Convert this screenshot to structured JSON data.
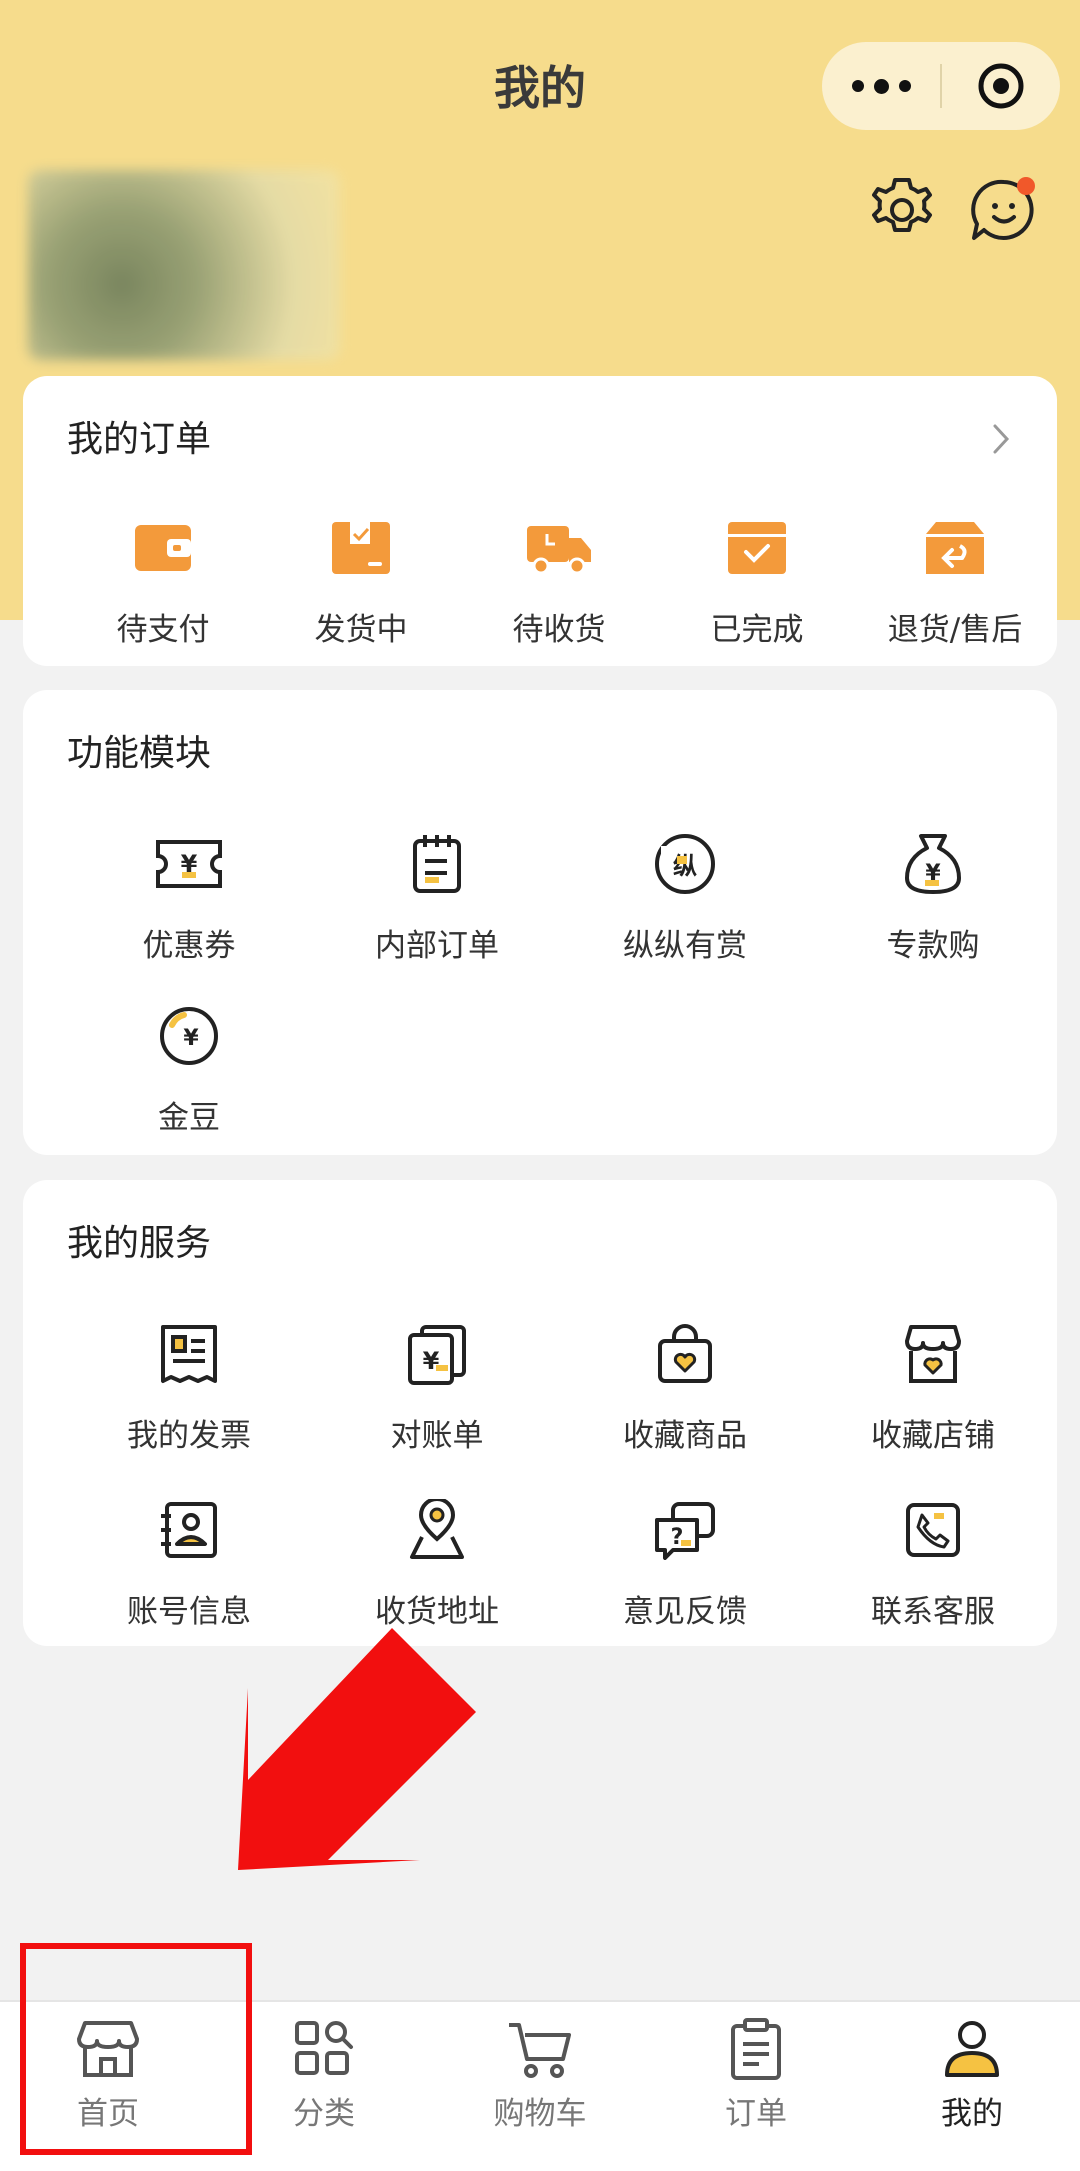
{
  "header": {
    "title": "我的"
  },
  "colors": {
    "brand_yellow": "#f6dc8c",
    "accent_orange": "#f39a3b",
    "annotation_red": "#f20f0f"
  },
  "orders": {
    "title": "我的订单",
    "items": [
      {
        "label": "待支付",
        "icon": "wallet-icon"
      },
      {
        "label": "发货中",
        "icon": "package-icon"
      },
      {
        "label": "待收货",
        "icon": "delivery-truck-icon"
      },
      {
        "label": "已完成",
        "icon": "completed-box-icon"
      },
      {
        "label": "退货/售后",
        "icon": "return-box-icon"
      }
    ]
  },
  "features": {
    "title": "功能模块",
    "items": [
      {
        "label": "优惠券",
        "icon": "coupon-icon"
      },
      {
        "label": "内部订单",
        "icon": "notepad-icon"
      },
      {
        "label": "纵纵有赏",
        "icon": "reward-badge-icon"
      },
      {
        "label": "专款购",
        "icon": "money-bag-icon"
      },
      {
        "label": "金豆",
        "icon": "gold-bean-icon"
      }
    ]
  },
  "services": {
    "title": "我的服务",
    "items": [
      {
        "label": "我的发票",
        "icon": "invoice-icon"
      },
      {
        "label": "对账单",
        "icon": "statement-icon"
      },
      {
        "label": "收藏商品",
        "icon": "favorite-product-icon"
      },
      {
        "label": "收藏店铺",
        "icon": "favorite-store-icon"
      },
      {
        "label": "账号信息",
        "icon": "account-info-icon"
      },
      {
        "label": "收货地址",
        "icon": "location-pin-icon"
      },
      {
        "label": "意见反馈",
        "icon": "feedback-icon"
      },
      {
        "label": "联系客服",
        "icon": "customer-service-icon"
      }
    ]
  },
  "tabbar": {
    "items": [
      {
        "label": "首页",
        "icon": "storefront-icon"
      },
      {
        "label": "分类",
        "icon": "category-grid-icon"
      },
      {
        "label": "购物车",
        "icon": "cart-icon"
      },
      {
        "label": "订单",
        "icon": "clipboard-icon"
      },
      {
        "label": "我的",
        "icon": "user-icon"
      }
    ],
    "active_index": 4
  }
}
